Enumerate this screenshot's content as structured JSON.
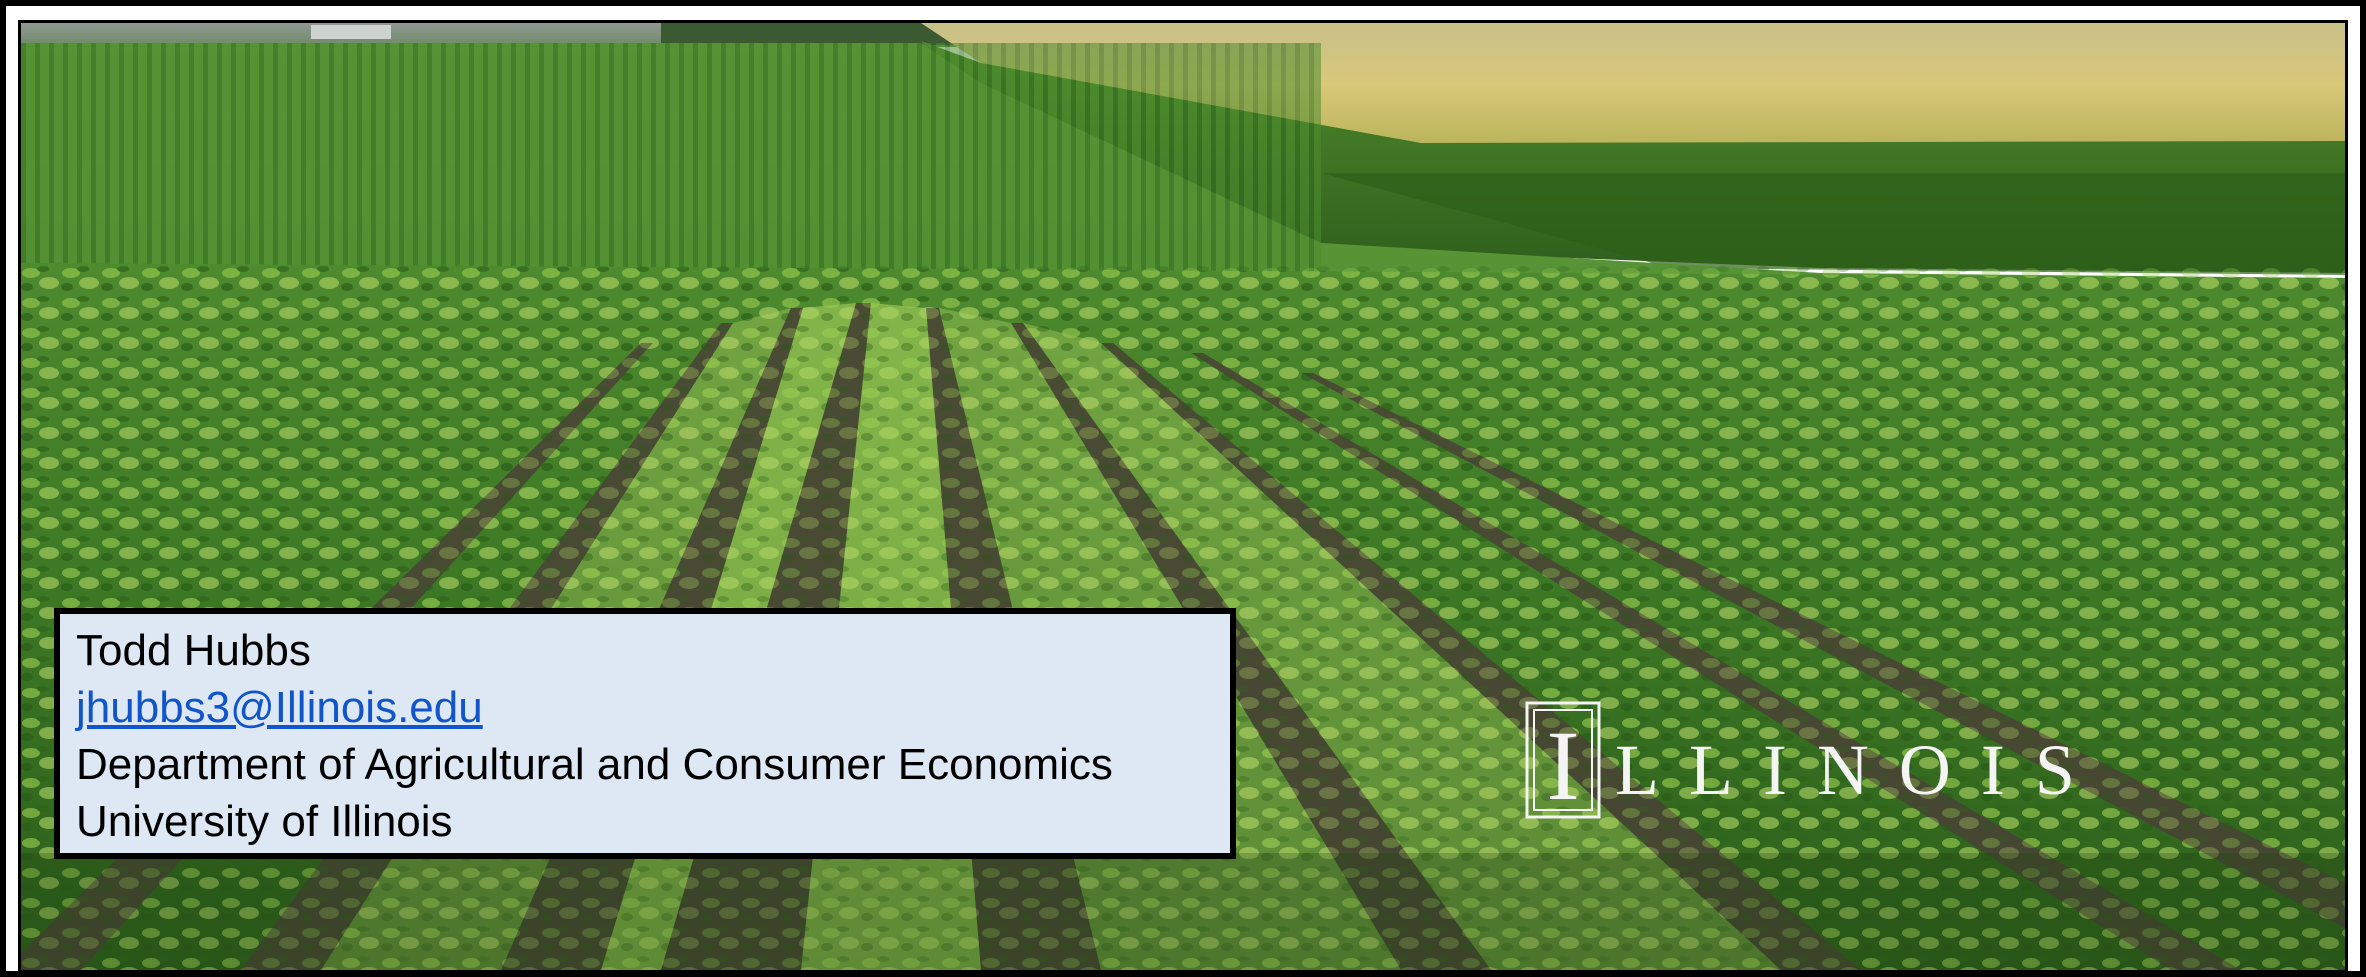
{
  "contact": {
    "name": "Todd Hubbs",
    "email": "jhubbs3@Illinois.edu",
    "department": "Department of Agricultural and Consumer Economics",
    "university": "University of Illinois"
  },
  "logo": {
    "wordmark": "ILLINOIS",
    "mark_letter": "I",
    "icon": "illinois-block-i-icon"
  },
  "scene": {
    "description_icon": "soybean-field-image",
    "colors": {
      "sky_haze": "#9fa7a3",
      "distant_crop": "#d9c77a",
      "corn_band": "#3f7b28",
      "soy_light": "#8ec24a",
      "soy_dark": "#2e6b1f",
      "soil": "#4a4236"
    }
  },
  "colors": {
    "box_background": "#dde8f4",
    "link": "#1155cc",
    "frame": "#000000"
  }
}
